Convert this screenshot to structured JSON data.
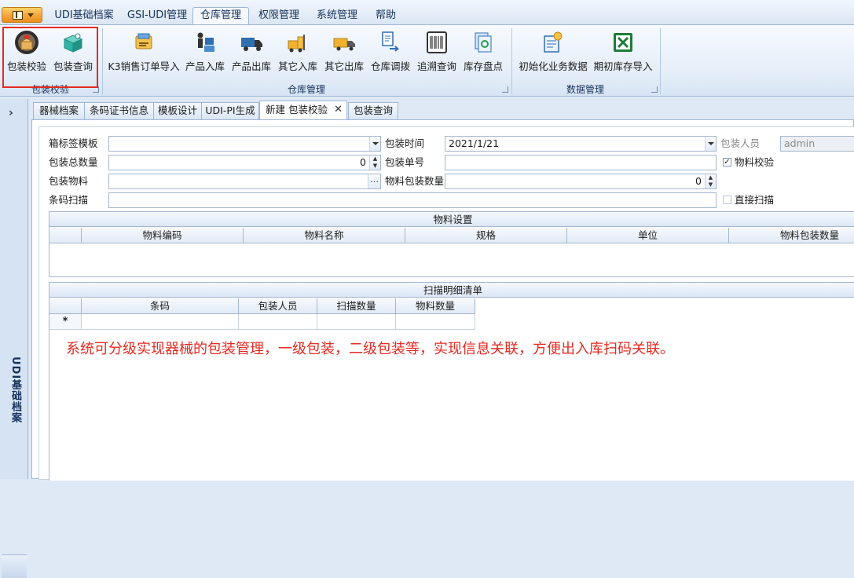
{
  "menu": {
    "tabs": [
      "UDI基础档案",
      "GSI-UDI管理",
      "仓库管理",
      "权限管理",
      "系统管理",
      "帮助"
    ],
    "active_index": 2
  },
  "ribbon": {
    "groups": [
      {
        "label": "包装校验",
        "buttons": [
          {
            "label": "包装校验",
            "icon": "package-check-icon"
          },
          {
            "label": "包装查询",
            "icon": "package-query-icon"
          }
        ]
      },
      {
        "label": "仓库管理",
        "buttons": [
          {
            "label": "K3销售订单导入",
            "icon": "k3-import-icon"
          },
          {
            "label": "产品入库",
            "icon": "product-inbound-icon"
          },
          {
            "label": "产品出库",
            "icon": "product-outbound-icon"
          },
          {
            "label": "其它入库",
            "icon": "other-inbound-icon"
          },
          {
            "label": "其它出库",
            "icon": "other-outbound-icon"
          },
          {
            "label": "仓库调拨",
            "icon": "warehouse-transfer-icon"
          },
          {
            "label": "追溯查询",
            "icon": "trace-query-icon"
          },
          {
            "label": "库存盘点",
            "icon": "inventory-count-icon"
          }
        ]
      },
      {
        "label": "数据管理",
        "buttons": [
          {
            "label": "初始化业务数据",
            "icon": "init-data-icon"
          },
          {
            "label": "期初库存导入",
            "icon": "excel-import-icon"
          }
        ]
      }
    ]
  },
  "left_panel": {
    "title": "UDI基础档案"
  },
  "doc_tabs": [
    "器械档案",
    "条码证书信息",
    "模板设计",
    "UDI-PI生成",
    "新建 包装校验",
    "包装查询"
  ],
  "doc_tabs_active": 4,
  "form": {
    "box_label_template": {
      "label": "箱标签模板",
      "value": ""
    },
    "pack_time": {
      "label": "包装时间",
      "value": "2021/1/21"
    },
    "packer": {
      "label": "包装人员",
      "value": "admin"
    },
    "total_qty": {
      "label": "包装总数量",
      "value": "0"
    },
    "pack_no": {
      "label": "包装单号",
      "value": ""
    },
    "material_check": {
      "label": "物料校验",
      "checked": true
    },
    "pack_material": {
      "label": "包装物料",
      "value": ""
    },
    "material_pack_qty": {
      "label": "物料包装数量",
      "value": "0"
    },
    "barcode_scan": {
      "label": "条码扫描",
      "value": ""
    },
    "direct_scan": {
      "label": "直接扫描",
      "checked": false
    }
  },
  "material_grid": {
    "title": "物料设置",
    "columns": [
      "物料编码",
      "物料名称",
      "规格",
      "单位",
      "物料包装数量"
    ]
  },
  "scan_grid": {
    "title": "扫描明细清单",
    "columns": [
      "条码",
      "包装人员",
      "扫描数量",
      "物料数量"
    ],
    "new_row_marker": "*"
  },
  "note": "系统可分级实现器械的包装管理，一级包装，二级包装等，实现信息关联，方便出入库扫码关联。",
  "colors": {
    "accent_red": "#e42a21",
    "ribbon_blue": "#dfe9f5"
  }
}
